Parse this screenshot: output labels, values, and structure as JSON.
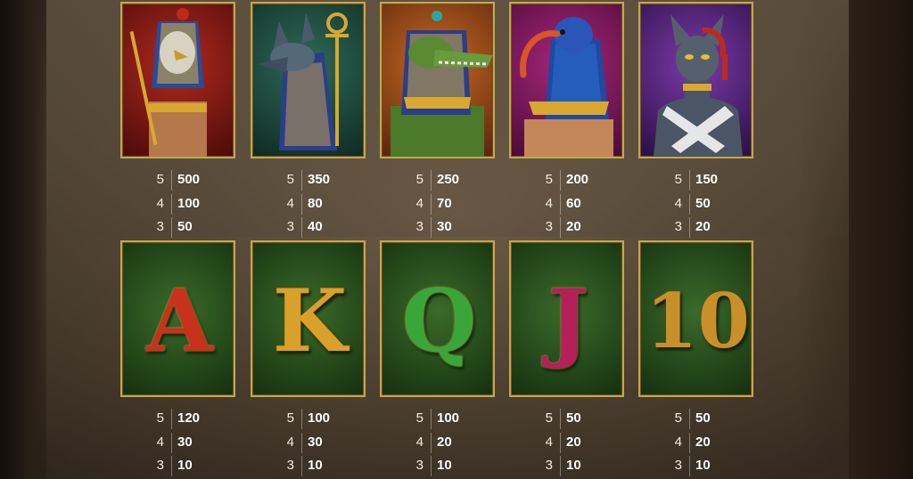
{
  "row1": [
    {
      "symbol": "falcon-god",
      "bg": "#7a1414",
      "counts": [
        "5",
        "4",
        "3"
      ],
      "values": [
        "500",
        "100",
        "50"
      ]
    },
    {
      "symbol": "jackal-god",
      "bg": "#1e4a3f",
      "counts": [
        "5",
        "4",
        "3"
      ],
      "values": [
        "350",
        "80",
        "40"
      ]
    },
    {
      "symbol": "crocodile-god",
      "bg": "#9a4a18",
      "counts": [
        "5",
        "4",
        "3"
      ],
      "values": [
        "250",
        "70",
        "30"
      ]
    },
    {
      "symbol": "ibis-god",
      "bg": "#7a1459",
      "counts": [
        "5",
        "4",
        "3"
      ],
      "values": [
        "200",
        "60",
        "20"
      ]
    },
    {
      "symbol": "cat-goddess",
      "bg": "#4b1f6e",
      "counts": [
        "5",
        "4",
        "3"
      ],
      "values": [
        "150",
        "50",
        "20"
      ]
    }
  ],
  "row2": [
    {
      "symbol": "letter-a",
      "glyph": "A",
      "color": "#c8321c",
      "counts": [
        "5",
        "4",
        "3"
      ],
      "values": [
        "120",
        "30",
        "10"
      ]
    },
    {
      "symbol": "letter-k",
      "glyph": "K",
      "color": "#d9a02a",
      "counts": [
        "5",
        "4",
        "3"
      ],
      "values": [
        "100",
        "30",
        "10"
      ]
    },
    {
      "symbol": "letter-q",
      "glyph": "Q",
      "color": "#3aa63a",
      "counts": [
        "5",
        "4",
        "3"
      ],
      "values": [
        "100",
        "20",
        "10"
      ]
    },
    {
      "symbol": "letter-j",
      "glyph": "J",
      "color": "#b3205a",
      "counts": [
        "5",
        "4",
        "3"
      ],
      "values": [
        "50",
        "20",
        "10"
      ]
    },
    {
      "symbol": "number-10",
      "glyph": "10",
      "color": "#c8902a",
      "counts": [
        "5",
        "4",
        "3"
      ],
      "values": [
        "50",
        "20",
        "10"
      ]
    }
  ]
}
